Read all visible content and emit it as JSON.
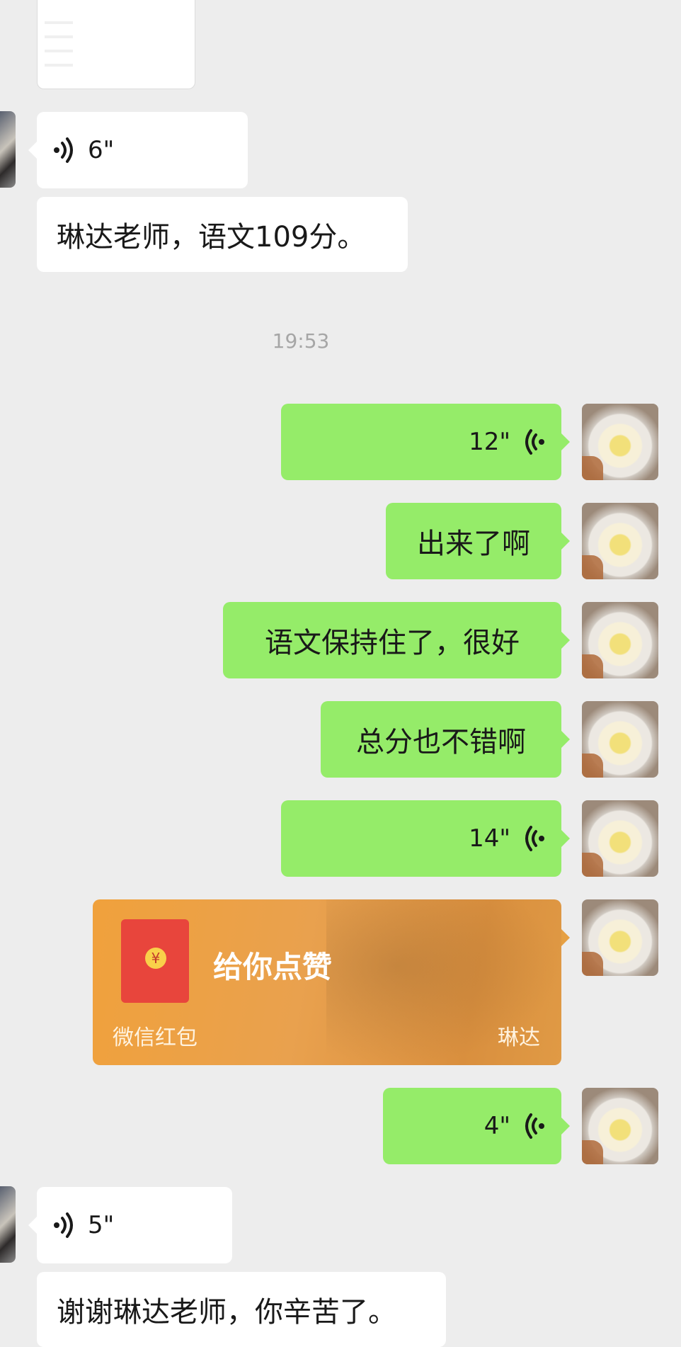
{
  "messages": {
    "voice_in_1": "6\"",
    "text_in_1": "琳达老师，语文109分。",
    "timestamp": "19:53",
    "voice_out_1": "12\"",
    "text_out_1": "出来了啊",
    "text_out_2": "语文保持住了，很好",
    "text_out_3": "总分也不错啊",
    "voice_out_2": "14\"",
    "voice_out_3": "4\"",
    "voice_in_2": "5\"",
    "text_in_2": "谢谢琳达老师，你辛苦了。"
  },
  "red_packet": {
    "message": "给你点赞",
    "brand": "微信红包",
    "sender": "琳达",
    "currency_symbol": "¥"
  },
  "colors": {
    "background": "#ededed",
    "bubble_self": "#95ec69",
    "bubble_other": "#ffffff",
    "red_packet": "#e6a043"
  }
}
